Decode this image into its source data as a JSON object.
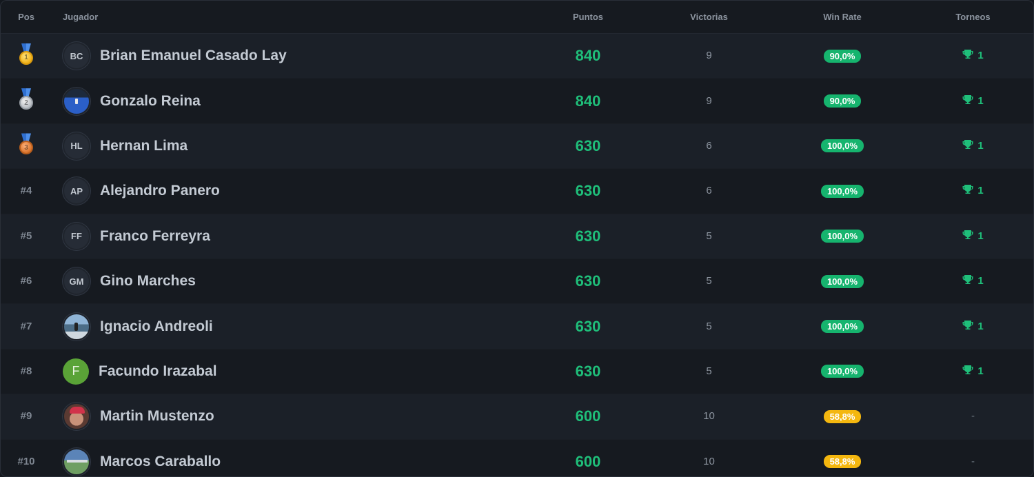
{
  "headers": {
    "pos": "Pos",
    "player": "Jugador",
    "points": "Puntos",
    "wins": "Victorias",
    "win_rate": "Win Rate",
    "tournaments": "Torneos"
  },
  "colors": {
    "accent_green": "#1fbf7a",
    "pill_green": "#16b46e",
    "pill_yellow": "#f4b70f"
  },
  "rows": [
    {
      "pos": "",
      "medal": "gold",
      "medal_number": "1",
      "avatar": "BC",
      "avatar_type": "initials",
      "name": "Brian Emanuel Casado Lay",
      "points": "840",
      "wins": "9",
      "win_rate": "90,0%",
      "win_rate_color": "green",
      "tournaments": "1",
      "has_trophy": true
    },
    {
      "pos": "",
      "medal": "silver",
      "medal_number": "2",
      "avatar": "",
      "avatar_type": "photo-court",
      "name": "Gonzalo Reina",
      "points": "840",
      "wins": "9",
      "win_rate": "90,0%",
      "win_rate_color": "green",
      "tournaments": "1",
      "has_trophy": true
    },
    {
      "pos": "",
      "medal": "bronze",
      "medal_number": "3",
      "avatar": "HL",
      "avatar_type": "initials",
      "name": "Hernan Lima",
      "points": "630",
      "wins": "6",
      "win_rate": "100,0%",
      "win_rate_color": "green",
      "tournaments": "1",
      "has_trophy": true
    },
    {
      "pos": "#4",
      "medal": "",
      "medal_number": "",
      "avatar": "AP",
      "avatar_type": "initials",
      "name": "Alejandro Panero",
      "points": "630",
      "wins": "6",
      "win_rate": "100,0%",
      "win_rate_color": "green",
      "tournaments": "1",
      "has_trophy": true
    },
    {
      "pos": "#5",
      "medal": "",
      "medal_number": "",
      "avatar": "FF",
      "avatar_type": "initials",
      "name": "Franco Ferreyra",
      "points": "630",
      "wins": "5",
      "win_rate": "100,0%",
      "win_rate_color": "green",
      "tournaments": "1",
      "has_trophy": true
    },
    {
      "pos": "#6",
      "medal": "",
      "medal_number": "",
      "avatar": "GM",
      "avatar_type": "initials",
      "name": "Gino Marches",
      "points": "630",
      "wins": "5",
      "win_rate": "100,0%",
      "win_rate_color": "green",
      "tournaments": "1",
      "has_trophy": true
    },
    {
      "pos": "#7",
      "medal": "",
      "medal_number": "",
      "avatar": "",
      "avatar_type": "photo-beach",
      "name": "Ignacio Andreoli",
      "points": "630",
      "wins": "5",
      "win_rate": "100,0%",
      "win_rate_color": "green",
      "tournaments": "1",
      "has_trophy": true
    },
    {
      "pos": "#8",
      "medal": "",
      "medal_number": "",
      "avatar": "F",
      "avatar_type": "letter",
      "name": "Facundo Irazabal",
      "points": "630",
      "wins": "5",
      "win_rate": "100,0%",
      "win_rate_color": "green",
      "tournaments": "1",
      "has_trophy": true
    },
    {
      "pos": "#9",
      "medal": "",
      "medal_number": "",
      "avatar": "",
      "avatar_type": "photo-face",
      "name": "Martin Mustenzo",
      "points": "600",
      "wins": "10",
      "win_rate": "58,8%",
      "win_rate_color": "yellow",
      "tournaments": "-",
      "has_trophy": false
    },
    {
      "pos": "#10",
      "medal": "",
      "medal_number": "",
      "avatar": "",
      "avatar_type": "photo-field",
      "name": "Marcos Caraballo",
      "points": "600",
      "wins": "10",
      "win_rate": "58,8%",
      "win_rate_color": "yellow",
      "tournaments": "-",
      "has_trophy": false
    }
  ]
}
